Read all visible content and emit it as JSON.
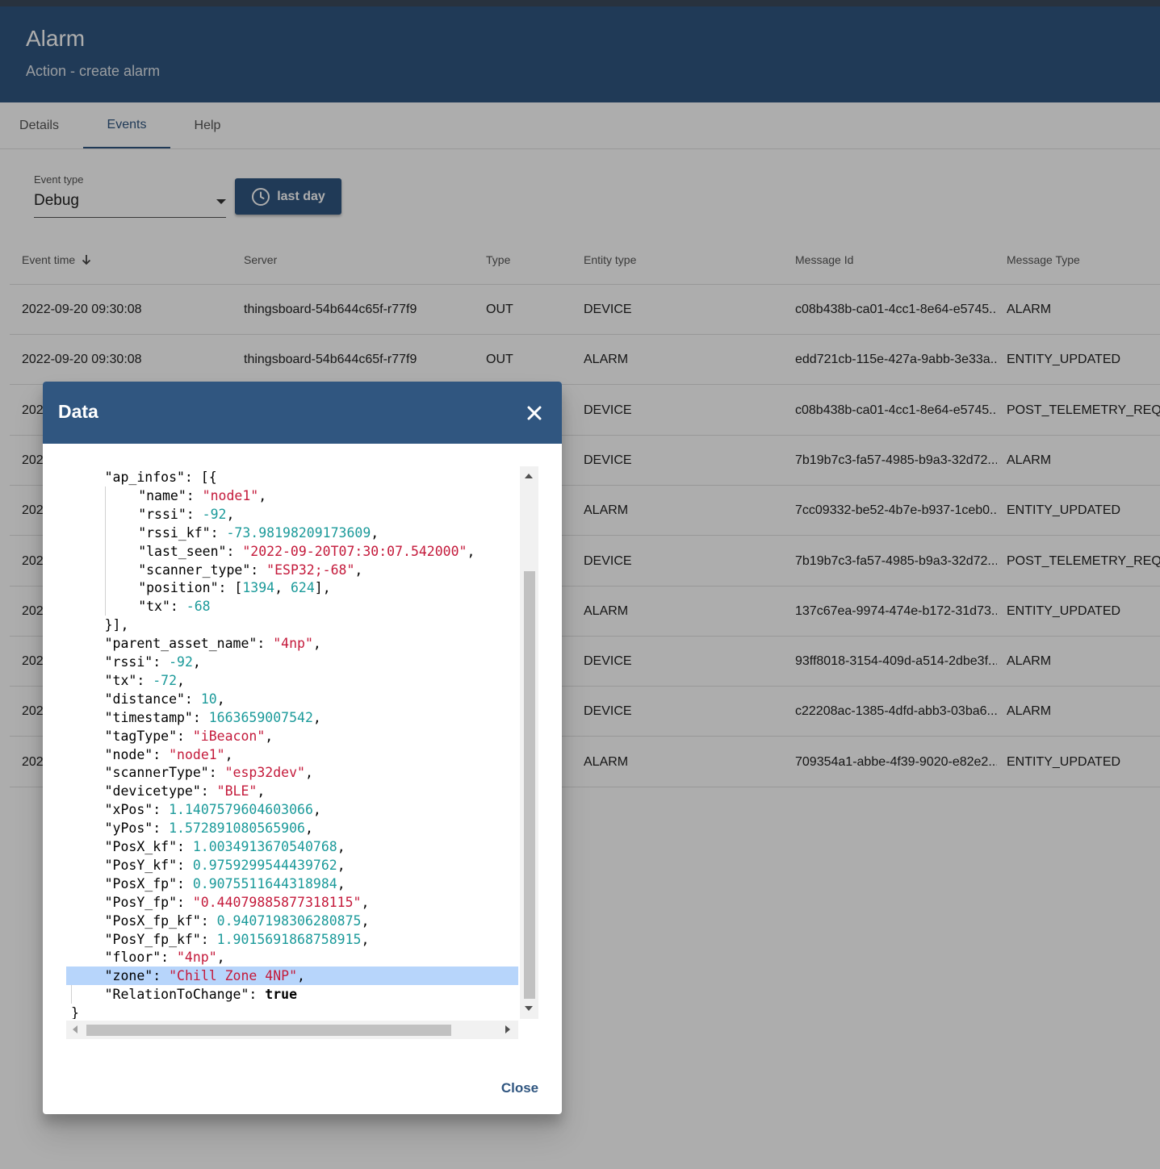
{
  "header": {
    "title": "Alarm",
    "subtitle": "Action - create alarm"
  },
  "tabs": [
    {
      "label": "Details"
    },
    {
      "label": "Events"
    },
    {
      "label": "Help"
    }
  ],
  "filters": {
    "event_type_label": "Event type",
    "event_type_value": "Debug",
    "time_button_label": "last day"
  },
  "table": {
    "columns": [
      "Event time",
      "Server",
      "Type",
      "Entity type",
      "Message Id",
      "Message Type"
    ],
    "rows": [
      {
        "time": "2022-09-20 09:30:08",
        "server": "thingsboard-54b644c65f-r77f9",
        "type": "OUT",
        "entity": "DEVICE",
        "msgid": "c08b438b-ca01-4cc1-8e64-e5745...",
        "msgtype": "ALARM"
      },
      {
        "time": "2022-09-20 09:30:08",
        "server": "thingsboard-54b644c65f-r77f9",
        "type": "OUT",
        "entity": "ALARM",
        "msgid": "edd721cb-115e-427a-9abb-3e33a...",
        "msgtype": "ENTITY_UPDATED"
      },
      {
        "time": "202",
        "server": "",
        "type": "",
        "entity": "DEVICE",
        "msgid": "c08b438b-ca01-4cc1-8e64-e5745...",
        "msgtype": "POST_TELEMETRY_REQUES"
      },
      {
        "time": "202",
        "server": "",
        "type": "",
        "entity": "DEVICE",
        "msgid": "7b19b7c3-fa57-4985-b9a3-32d72...",
        "msgtype": "ALARM"
      },
      {
        "time": "202",
        "server": "",
        "type": "",
        "entity": "ALARM",
        "msgid": "7cc09332-be52-4b7e-b937-1ceb0...",
        "msgtype": "ENTITY_UPDATED"
      },
      {
        "time": "202",
        "server": "",
        "type": "",
        "entity": "DEVICE",
        "msgid": "7b19b7c3-fa57-4985-b9a3-32d72...",
        "msgtype": "POST_TELEMETRY_REQUES"
      },
      {
        "time": "202",
        "server": "",
        "type": "",
        "entity": "ALARM",
        "msgid": "137c67ea-9974-474e-b172-31d73...",
        "msgtype": "ENTITY_UPDATED"
      },
      {
        "time": "202",
        "server": "",
        "type": "",
        "entity": "DEVICE",
        "msgid": "93ff8018-3154-409d-a514-2dbe3f...",
        "msgtype": "ALARM"
      },
      {
        "time": "202",
        "server": "",
        "type": "",
        "entity": "DEVICE",
        "msgid": "c22208ac-1385-4dfd-abb3-03ba6...",
        "msgtype": "ALARM"
      },
      {
        "time": "202",
        "server": "",
        "type": "",
        "entity": "ALARM",
        "msgid": "709354a1-abbe-4f39-9020-e82e2...",
        "msgtype": "ENTITY_UPDATED"
      }
    ]
  },
  "dialog": {
    "title": "Data",
    "close_label": "Close",
    "code_lines": [
      {
        "indent": 4,
        "parts": [
          [
            "k",
            "\"ap_infos\": [{"
          ]
        ]
      },
      {
        "indent": 8,
        "parts": [
          [
            "k",
            "\"name\": "
          ],
          [
            "s",
            "\"node1\""
          ],
          [
            "k",
            ","
          ]
        ]
      },
      {
        "indent": 8,
        "parts": [
          [
            "k",
            "\"rssi\": "
          ],
          [
            "n",
            "-92"
          ],
          [
            "k",
            ","
          ]
        ]
      },
      {
        "indent": 8,
        "parts": [
          [
            "k",
            "\"rssi_kf\": "
          ],
          [
            "n",
            "-73.98198209173609"
          ],
          [
            "k",
            ","
          ]
        ]
      },
      {
        "indent": 8,
        "parts": [
          [
            "k",
            "\"last_seen\": "
          ],
          [
            "s",
            "\"2022-09-20T07:30:07.542000\""
          ],
          [
            "k",
            ","
          ]
        ]
      },
      {
        "indent": 8,
        "parts": [
          [
            "k",
            "\"scanner_type\": "
          ],
          [
            "s",
            "\"ESP32;-68\""
          ],
          [
            "k",
            ","
          ]
        ]
      },
      {
        "indent": 8,
        "parts": [
          [
            "k",
            "\"position\": ["
          ],
          [
            "n",
            "1394"
          ],
          [
            "k",
            ", "
          ],
          [
            "n",
            "624"
          ],
          [
            "k",
            "],"
          ]
        ]
      },
      {
        "indent": 8,
        "parts": [
          [
            "k",
            "\"tx\": "
          ],
          [
            "n",
            "-68"
          ]
        ]
      },
      {
        "indent": 4,
        "parts": [
          [
            "k",
            "}],"
          ]
        ]
      },
      {
        "indent": 4,
        "parts": [
          [
            "k",
            "\"parent_asset_name\": "
          ],
          [
            "s",
            "\"4np\""
          ],
          [
            "k",
            ","
          ]
        ]
      },
      {
        "indent": 4,
        "parts": [
          [
            "k",
            "\"rssi\": "
          ],
          [
            "n",
            "-92"
          ],
          [
            "k",
            ","
          ]
        ]
      },
      {
        "indent": 4,
        "parts": [
          [
            "k",
            "\"tx\": "
          ],
          [
            "n",
            "-72"
          ],
          [
            "k",
            ","
          ]
        ]
      },
      {
        "indent": 4,
        "parts": [
          [
            "k",
            "\"distance\": "
          ],
          [
            "n",
            "10"
          ],
          [
            "k",
            ","
          ]
        ]
      },
      {
        "indent": 4,
        "parts": [
          [
            "k",
            "\"timestamp\": "
          ],
          [
            "n",
            "1663659007542"
          ],
          [
            "k",
            ","
          ]
        ]
      },
      {
        "indent": 4,
        "parts": [
          [
            "k",
            "\"tagType\": "
          ],
          [
            "s",
            "\"iBeacon\""
          ],
          [
            "k",
            ","
          ]
        ]
      },
      {
        "indent": 4,
        "parts": [
          [
            "k",
            "\"node\": "
          ],
          [
            "s",
            "\"node1\""
          ],
          [
            "k",
            ","
          ]
        ]
      },
      {
        "indent": 4,
        "parts": [
          [
            "k",
            "\"scannerType\": "
          ],
          [
            "s",
            "\"esp32dev\""
          ],
          [
            "k",
            ","
          ]
        ]
      },
      {
        "indent": 4,
        "parts": [
          [
            "k",
            "\"devicetype\": "
          ],
          [
            "s",
            "\"BLE\""
          ],
          [
            "k",
            ","
          ]
        ]
      },
      {
        "indent": 4,
        "parts": [
          [
            "k",
            "\"xPos\": "
          ],
          [
            "n",
            "1.1407579604603066"
          ],
          [
            "k",
            ","
          ]
        ]
      },
      {
        "indent": 4,
        "parts": [
          [
            "k",
            "\"yPos\": "
          ],
          [
            "n",
            "1.572891080565906"
          ],
          [
            "k",
            ","
          ]
        ]
      },
      {
        "indent": 4,
        "parts": [
          [
            "k",
            "\"PosX_kf\": "
          ],
          [
            "n",
            "1.0034913670540768"
          ],
          [
            "k",
            ","
          ]
        ]
      },
      {
        "indent": 4,
        "parts": [
          [
            "k",
            "\"PosY_kf\": "
          ],
          [
            "n",
            "0.9759299544439762"
          ],
          [
            "k",
            ","
          ]
        ]
      },
      {
        "indent": 4,
        "parts": [
          [
            "k",
            "\"PosX_fp\": "
          ],
          [
            "n",
            "0.9075511644318984"
          ],
          [
            "k",
            ","
          ]
        ]
      },
      {
        "indent": 4,
        "parts": [
          [
            "k",
            "\"PosY_fp\": "
          ],
          [
            "s",
            "\"0.44079885877318115\""
          ],
          [
            "k",
            ","
          ]
        ]
      },
      {
        "indent": 4,
        "parts": [
          [
            "k",
            "\"PosX_fp_kf\": "
          ],
          [
            "n",
            "0.9407198306280875"
          ],
          [
            "k",
            ","
          ]
        ]
      },
      {
        "indent": 4,
        "parts": [
          [
            "k",
            "\"PosY_fp_kf\": "
          ],
          [
            "n",
            "1.9015691868758915"
          ],
          [
            "k",
            ","
          ]
        ]
      },
      {
        "indent": 4,
        "parts": [
          [
            "k",
            "\"floor\": "
          ],
          [
            "s",
            "\"4np\""
          ],
          [
            "k",
            ","
          ]
        ]
      },
      {
        "indent": 4,
        "parts": [
          [
            "k",
            "\"zone\": "
          ],
          [
            "s",
            "\"Chill Zone 4NP\""
          ],
          [
            "k",
            ","
          ]
        ],
        "highlight": true
      },
      {
        "indent": 4,
        "parts": [
          [
            "k",
            "\"RelationToChange\": "
          ],
          [
            "b",
            "true"
          ]
        ]
      },
      {
        "indent": 0,
        "parts": [
          [
            "k",
            "}"
          ]
        ]
      }
    ]
  },
  "colors": {
    "primary": "#305680",
    "json_string": "#c41a3b",
    "json_number": "#1b9a9a",
    "selection": "#b7d5fb"
  },
  "icons": [
    "clock-icon",
    "sort-arrow-down-icon",
    "close-icon",
    "dropdown-arrow-icon"
  ]
}
